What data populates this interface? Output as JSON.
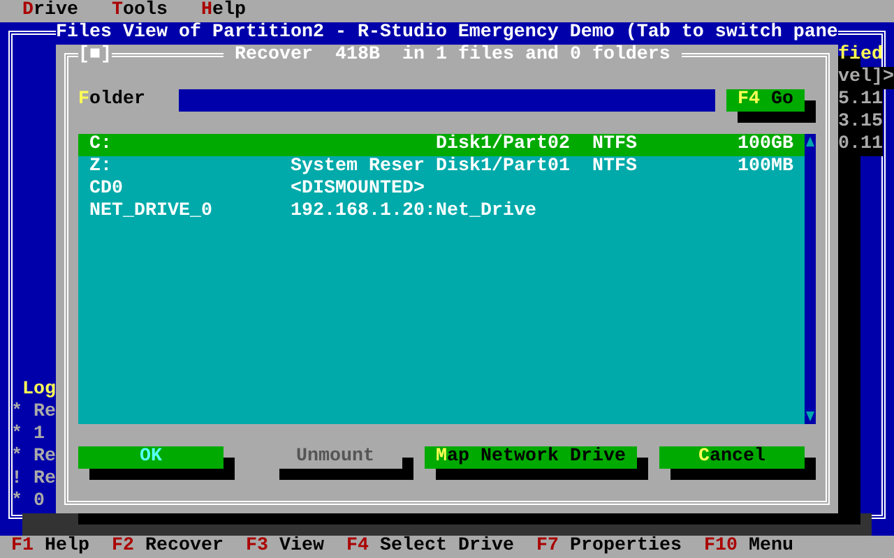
{
  "menu": [
    {
      "label": "Drive"
    },
    {
      "label": "Tools"
    },
    {
      "label": "Help"
    }
  ],
  "background_window": {
    "title": "Files View of Partition2 - R-Studio Emergency Demo (Tab to switch pane",
    "right_fragments": [
      "fied",
      "vel]>",
      "5.11",
      "3.15",
      "0.11"
    ],
    "log_title": "Log",
    "log_lines": [
      "* Re",
      "* 1",
      "* Re",
      "! Re",
      "* 0"
    ]
  },
  "dialog": {
    "close_box": "[■]",
    "title": "Recover  418B  in 1 files and 0 folders",
    "folder_label": "Folder",
    "go_button": "F4 Go",
    "drives": [
      {
        "name": "C:",
        "location": "Disk1/Part02",
        "fs": "NTFS",
        "size": "100GB",
        "selected": true
      },
      {
        "name": "Z:",
        "label": "System Reser",
        "location": "Disk1/Part01",
        "fs": "NTFS",
        "size": "100MB",
        "selected": false
      },
      {
        "name": "CD0",
        "label": "<DISMOUNTED>",
        "selected": false
      },
      {
        "name": "NET_DRIVE_0",
        "label": "192.168.1.20:Net_Drive",
        "selected": false
      }
    ],
    "buttons": [
      {
        "label": "OK",
        "disabled": false,
        "hotkey_highlighted": false
      },
      {
        "label": "Unmount",
        "disabled": true,
        "hotkey_highlighted": false
      },
      {
        "label": "Map Network Drive",
        "disabled": false,
        "hotkey_highlighted": true
      },
      {
        "label": "Cancel",
        "disabled": false,
        "hotkey_highlighted": true
      }
    ]
  },
  "function_keys": [
    {
      "key": "F1",
      "label": "Help"
    },
    {
      "key": "F2",
      "label": "Recover"
    },
    {
      "key": "F3",
      "label": "View"
    },
    {
      "key": "F4",
      "label": "Select Drive"
    },
    {
      "key": "F7",
      "label": "Properties"
    },
    {
      "key": "F10",
      "label": "Menu"
    }
  ]
}
